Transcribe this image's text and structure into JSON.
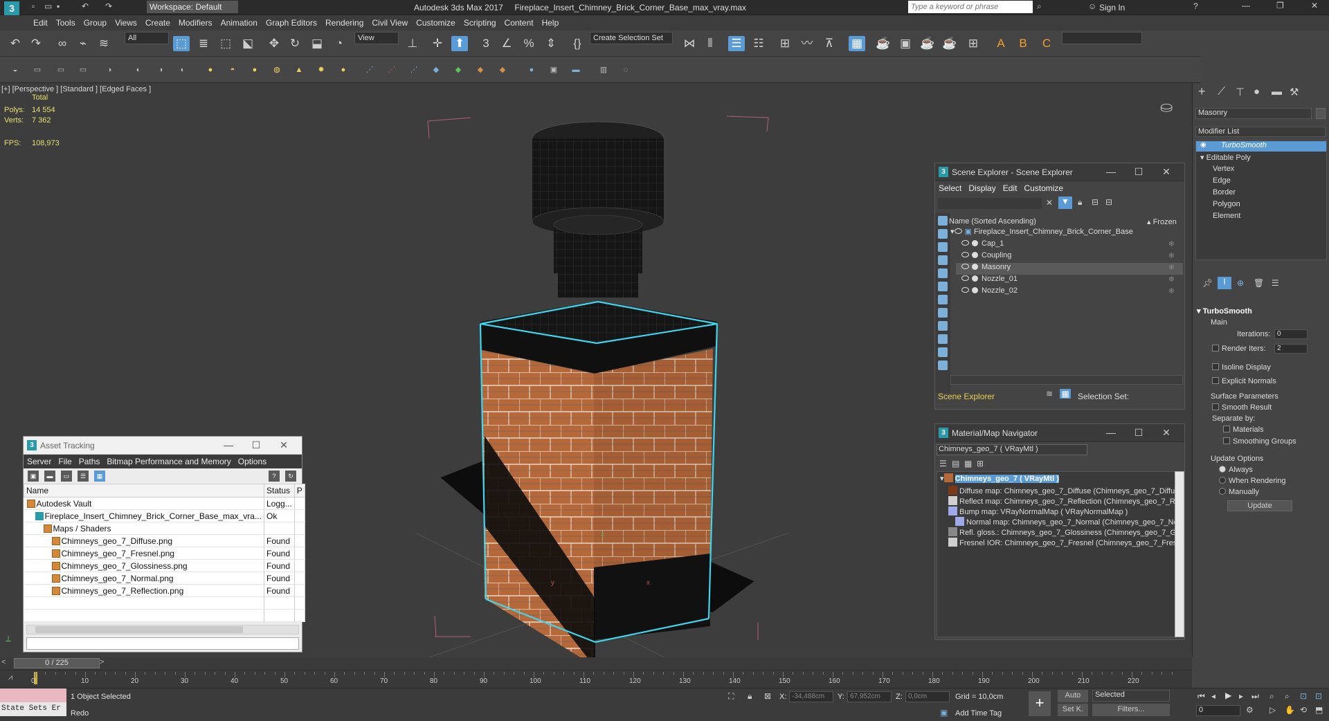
{
  "titlebar": {
    "app_logo": "3",
    "workspace": "Workspace: Default",
    "title": "Autodesk 3ds Max 2017     Fireplace_Insert_Chimney_Brick_Corner_Base_max_vray.max",
    "search_placeholder": "Type a keyword or phrase",
    "sign_in": "Sign In"
  },
  "menu": [
    "Edit",
    "Tools",
    "Group",
    "Views",
    "Create",
    "Modifiers",
    "Animation",
    "Graph Editors",
    "Rendering",
    "Civil View",
    "Customize",
    "Scripting",
    "Content",
    "Help"
  ],
  "toolbar": {
    "filter_select": "All",
    "ref_coord": "View",
    "selection_set": "Create Selection Set"
  },
  "viewport": {
    "label": "[+] [Perspective ] [Standard ] [Edged Faces ]",
    "stats_header": "Total",
    "polys_label": "Polys:",
    "polys_value": "14 554",
    "verts_label": "Verts:",
    "verts_value": "7 362",
    "fps_label": "FPS:",
    "fps_value": "108,973"
  },
  "asset_tracking": {
    "title": "Asset Tracking",
    "menu": [
      "Server",
      "File",
      "Paths",
      "Bitmap Performance and Memory",
      "Options"
    ],
    "col_name": "Name",
    "col_status": "Status",
    "col_p": "P",
    "rows": [
      {
        "name": "Autodesk Vault",
        "status": "Logg...",
        "indent": 0,
        "icon": "vault"
      },
      {
        "name": "Fireplace_Insert_Chimney_Brick_Corner_Base_max_vra...",
        "status": "Ok",
        "indent": 1,
        "icon": "max"
      },
      {
        "name": "Maps / Shaders",
        "status": "",
        "indent": 2,
        "icon": "folder"
      },
      {
        "name": "Chimneys_geo_7_Diffuse.png",
        "status": "Found",
        "indent": 3,
        "icon": "file"
      },
      {
        "name": "Chimneys_geo_7_Fresnel.png",
        "status": "Found",
        "indent": 3,
        "icon": "file"
      },
      {
        "name": "Chimneys_geo_7_Glossiness.png",
        "status": "Found",
        "indent": 3,
        "icon": "file"
      },
      {
        "name": "Chimneys_geo_7_Normal.png",
        "status": "Found",
        "indent": 3,
        "icon": "file"
      },
      {
        "name": "Chimneys_geo_7_Reflection.png",
        "status": "Found",
        "indent": 3,
        "icon": "file"
      }
    ]
  },
  "scene_explorer": {
    "title": "Scene Explorer - Scene Explorer",
    "menu": [
      "Select",
      "Display",
      "Edit",
      "Customize"
    ],
    "col_name": "Name (Sorted Ascending)",
    "col_frozen": "▴ Frozen",
    "root": "Fireplace_Insert_Chimney_Brick_Corner_Base",
    "items": [
      "Cap_1",
      "Coupling",
      "Masonry",
      "Nozzle_01",
      "Nozzle_02"
    ],
    "selected_index": 2,
    "footer_label": "Scene Explorer",
    "selection_set_label": "Selection Set:"
  },
  "material_navigator": {
    "title": "Material/Map Navigator",
    "current": "Chimneys_geo_7  ( VRayMtl )",
    "root": "Chimneys_geo_7  ( VRayMtl )",
    "maps": [
      "Diffuse map: Chimneys_geo_7_Diffuse (Chimneys_geo_7_Diffus",
      "Reflect map: Chimneys_geo_7_Reflection (Chimneys_geo_7_Re",
      "Bump map: VRayNormalMap  ( VRayNormalMap )",
      "Normal map: Chimneys_geo_7_Normal (Chimneys_geo_7_Nor",
      "Refl. gloss.: Chimneys_geo_7_Glossiness (Chimneys_geo_7_Glos",
      "Fresnel IOR: Chimneys_geo_7_Fresnel (Chimneys_geo_7_Fresn"
    ]
  },
  "command_panel": {
    "object_name": "Masonry",
    "modifier_list": "Modifier List",
    "stack": [
      "TurboSmooth",
      "Editable Poly",
      "Vertex",
      "Edge",
      "Border",
      "Polygon",
      "Element"
    ],
    "rollout_title": "TurboSmooth",
    "main_label": "Main",
    "iterations_label": "Iterations:",
    "iterations_value": "0",
    "render_iters_label": "Render Iters:",
    "render_iters_value": "2",
    "isoline": "Isoline Display",
    "explicit_normals": "Explicit Normals",
    "surface_params": "Surface Parameters",
    "smooth_result": "Smooth Result",
    "separate_by": "Separate by:",
    "materials": "Materials",
    "smoothing_groups": "Smoothing Groups",
    "update_options": "Update Options",
    "always": "Always",
    "when_rendering": "When Rendering",
    "manually": "Manually",
    "update_btn": "Update"
  },
  "timeline": {
    "frame": "0 / 225",
    "ticks": [
      "0",
      "10",
      "20",
      "30",
      "40",
      "50",
      "60",
      "70",
      "80",
      "90",
      "100",
      "110",
      "120",
      "130",
      "140",
      "150",
      "160",
      "170",
      "180",
      "190",
      "200",
      "210",
      "220"
    ]
  },
  "status": {
    "state_sets": "State Sets Er",
    "selected": "1 Object Selected",
    "prompt": "Redo",
    "x_label": "X:",
    "x_value": "-34,488cm",
    "y_label": "Y:",
    "y_value": "67,952cm",
    "z_label": "Z:",
    "z_value": "0,0cm",
    "grid": "Grid = 10,0cm",
    "add_time_tag": "Add Time Tag",
    "auto": "Auto",
    "set_k": "Set K.",
    "selected_dd": "Selected",
    "filters": "Filters...",
    "frame_field": "0"
  }
}
